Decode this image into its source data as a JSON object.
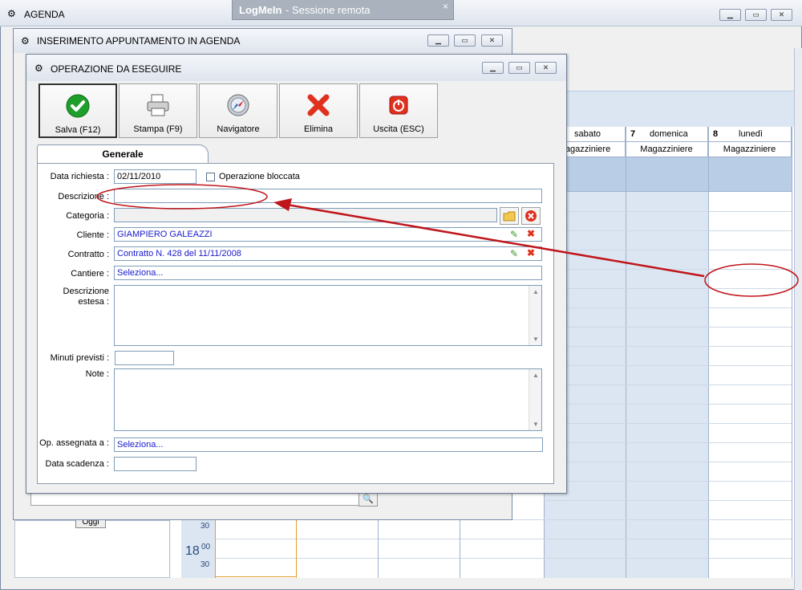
{
  "app": {
    "title": "AGENDA",
    "remote_banner": {
      "brand": "LogMeIn",
      "subtitle": " - Sessione remota",
      "close": "×"
    }
  },
  "window_agenda_insert": {
    "title": "INSERIMENTO APPUNTAMENTO IN AGENDA"
  },
  "dialog": {
    "title": "OPERAZIONE DA ESEGUIRE",
    "toolbar": {
      "save": "Salva (F12)",
      "print": "Stampa (F9)",
      "navigator": "Navigatore",
      "delete": "Elimina",
      "exit": "Uscita (ESC)"
    },
    "tab": "Generale",
    "form": {
      "data_richiesta_label": "Data richiesta :",
      "data_richiesta_value": "02/11/2010",
      "operazione_bloccata_label": "Operazione bloccata",
      "descrizione_label": "Descrizione :",
      "descrizione_value": "",
      "categoria_label": "Categoria :",
      "categoria_value": "",
      "cliente_label": "Cliente :",
      "cliente_value": "GIAMPIERO GALEAZZI",
      "contratto_label": "Contratto :",
      "contratto_value": "Contratto N. 428 del 11/11/2008",
      "cantiere_label": "Cantiere :",
      "cantiere_value": "Seleziona...",
      "descrizione_estesa_label_1": "Descrizione",
      "descrizione_estesa_label_2": "estesa :",
      "minuti_previsti_label": "Minuti previsti :",
      "note_label": "Note :",
      "op_assegnata_label": "Op. assegnata a :",
      "op_assegnata_value": "Seleziona...",
      "data_scadenza_label": "Data scadenza :",
      "data_scadenza_value": ""
    }
  },
  "calendar": {
    "days": [
      {
        "num": "",
        "name": "sabato",
        "role": "Magazziniere"
      },
      {
        "num": "7",
        "name": "domenica",
        "role": "Magazziniere"
      },
      {
        "num": "8",
        "name": "lunedì",
        "role": "Magazziniere"
      }
    ],
    "time_30a": "30",
    "time_18": "18",
    "time_00": "00",
    "time_30b": "30",
    "oggi_button": "Oggi"
  },
  "colors": {
    "accent_red": "#c0161b",
    "calendar_blue": "#b9cde6",
    "save_green": "#1e9e2a"
  }
}
